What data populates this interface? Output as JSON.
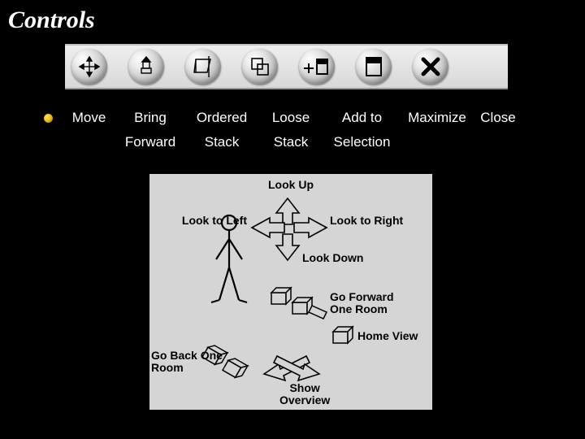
{
  "title": "Controls",
  "toolbar": [
    {
      "icon": "move-arrows",
      "label_line1": "Move",
      "label_line2": ""
    },
    {
      "icon": "bring-forward",
      "label_line1": "Bring",
      "label_line2": "Forward"
    },
    {
      "icon": "ordered-stack",
      "label_line1": "Ordered",
      "label_line2": "Stack"
    },
    {
      "icon": "loose-stack",
      "label_line1": "Loose",
      "label_line2": "Stack"
    },
    {
      "icon": "add-selection",
      "label_line1": "Add to",
      "label_line2": "Selection"
    },
    {
      "icon": "maximize",
      "label_line1": "Maximize",
      "label_line2": ""
    },
    {
      "icon": "close-x",
      "label_line1": "Close",
      "label_line2": ""
    }
  ],
  "diagram": {
    "look_up": "Look Up",
    "look_left": "Look to Left",
    "look_right": "Look to Right",
    "look_down": "Look Down",
    "go_forward": "Go Forward\nOne Room",
    "home_view": "Home View",
    "go_back": "Go Back One\nRoom",
    "show_overview": "Show\nOverview"
  }
}
